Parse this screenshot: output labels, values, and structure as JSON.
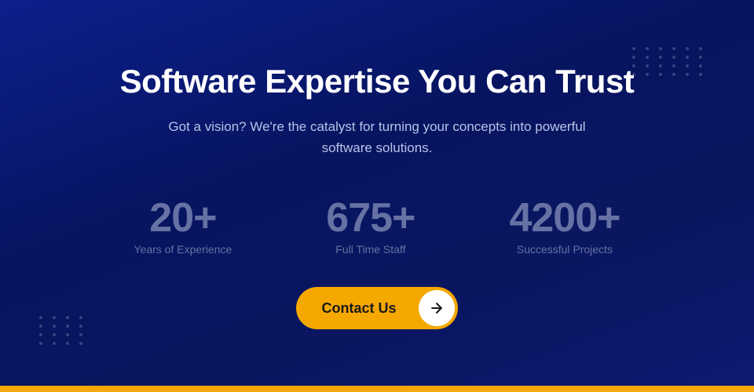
{
  "page": {
    "background_color_start": "#0d1f8c",
    "background_color_end": "#071460",
    "bottom_bar_color": "#f5a800"
  },
  "hero": {
    "title": "Software Expertise You Can Trust",
    "subtitle": "Got a vision? We're the catalyst for turning your concepts into powerful software solutions."
  },
  "stats": [
    {
      "number": "20+",
      "label": "Years of Experience"
    },
    {
      "number": "675+",
      "label": "Full Time Staff"
    },
    {
      "number": "4200+",
      "label": "Successful Projects"
    }
  ],
  "cta": {
    "button_label": "Contact Us"
  },
  "dots": {
    "top_right_rows": 4,
    "top_right_cols": 6,
    "bottom_left_rows": 4,
    "bottom_left_cols": 4
  }
}
